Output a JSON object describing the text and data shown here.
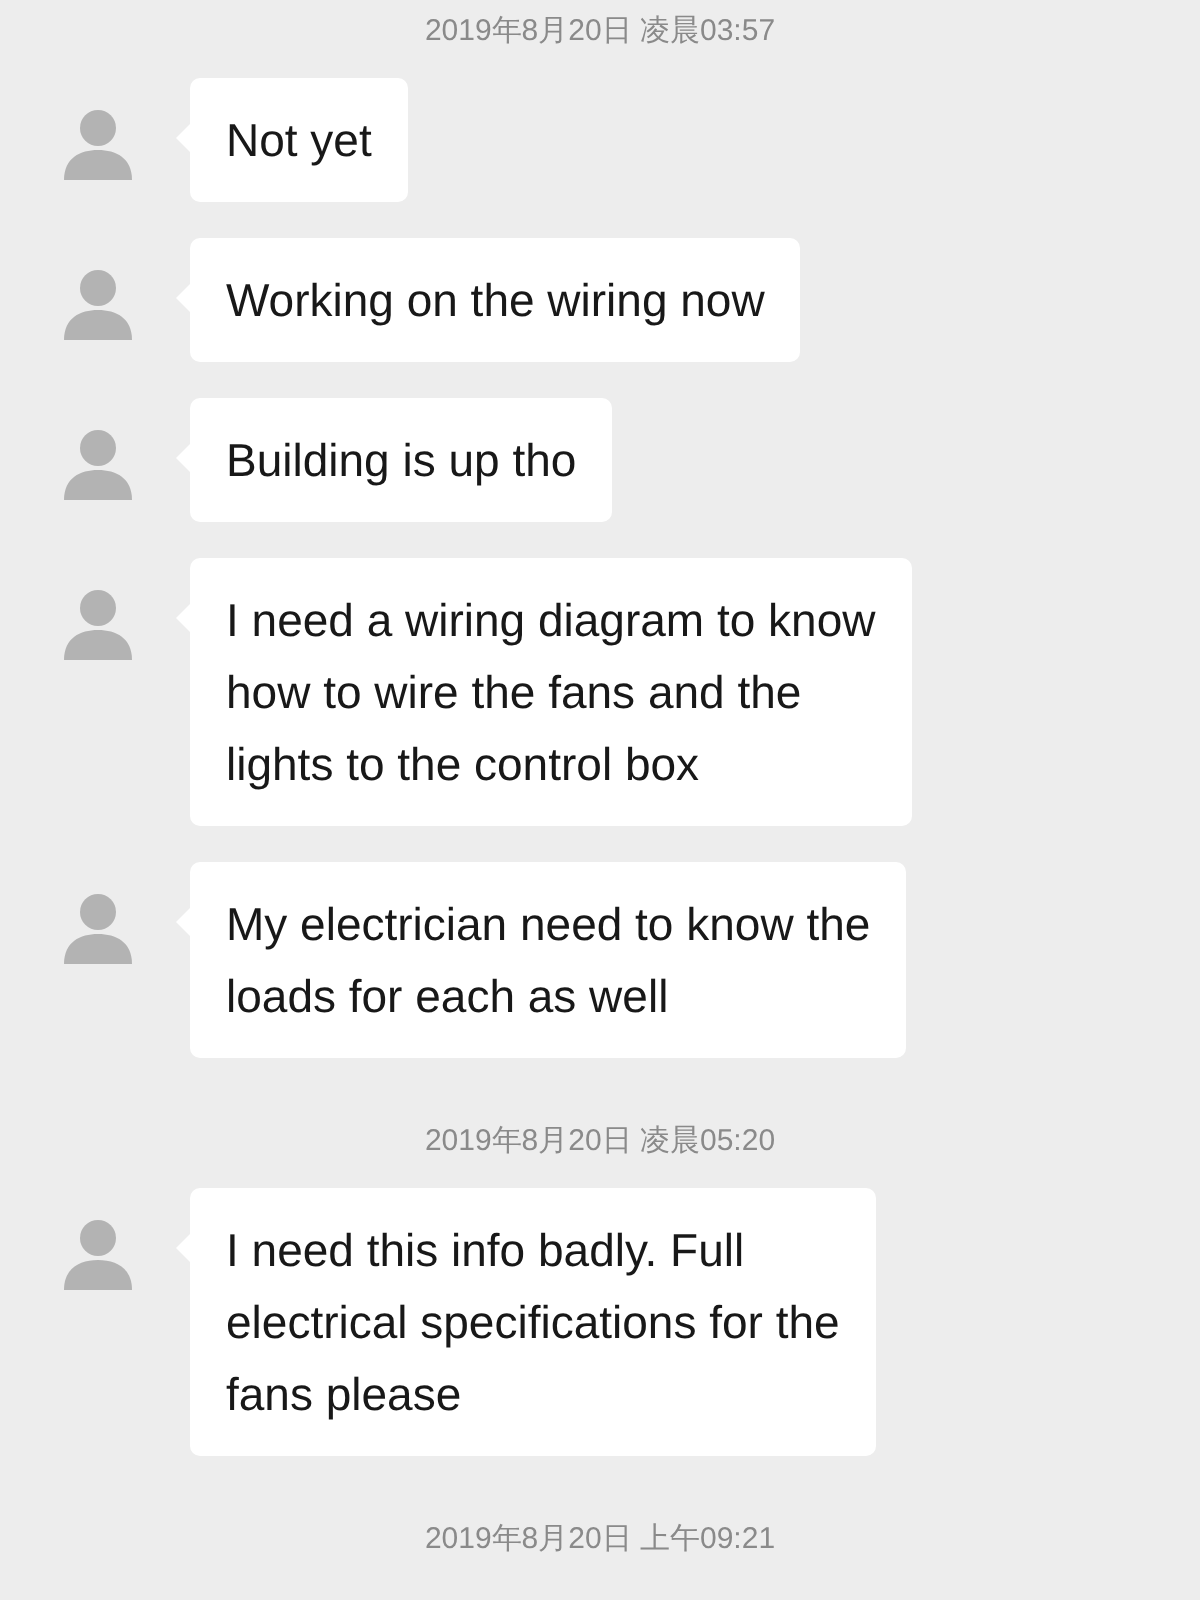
{
  "items": [
    {
      "kind": "time",
      "text": "2019年8月20日 凌晨03:57"
    },
    {
      "kind": "message",
      "text": "Not yet"
    },
    {
      "kind": "message",
      "text": "Working on the wiring now"
    },
    {
      "kind": "message",
      "text": "Building is up tho"
    },
    {
      "kind": "message",
      "text": "I need a wiring diagram to know\nhow to wire the fans and the\nlights to the control box"
    },
    {
      "kind": "message",
      "text": "My electrician need to know the\nloads for each as well"
    },
    {
      "kind": "time",
      "text": "2019年8月20日 凌晨05:20"
    },
    {
      "kind": "message",
      "text": "I need this info badly. Full\nelectrical specifications for the\nfans please"
    },
    {
      "kind": "time",
      "text": "2019年8月20日 上午09:21"
    }
  ]
}
